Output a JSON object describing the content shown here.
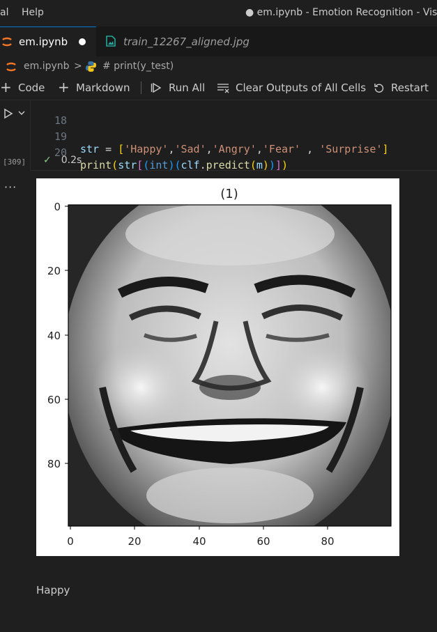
{
  "titlebar": {
    "menu": [
      "al",
      "Help"
    ],
    "title": "● em.ipynb - Emotion Recognition - Visua"
  },
  "tabs": [
    {
      "label": "em.ipynb",
      "modified": true
    },
    {
      "label": "train_12267_aligned.jpg"
    }
  ],
  "breadcrumb": {
    "file": "em.ipynb",
    "separator": ">",
    "cell": "# print(y_test)"
  },
  "toolbar": {
    "code_label": "Code",
    "markdown_label": "Markdown",
    "run_all_label": "Run All",
    "clear_label": "Clear Outputs of All Cells",
    "restart_label": "Restart"
  },
  "cell": {
    "line_numbers": [
      "18",
      "19",
      "20"
    ],
    "execution_count": "[309]",
    "duration": "0.2s"
  },
  "figure": {
    "image_title": "(1)",
    "y_ticks": [
      "0",
      "20",
      "40",
      "60",
      "80"
    ],
    "x_ticks": [
      "0",
      "20",
      "40",
      "60",
      "80"
    ],
    "image": "grayscale-face-icon"
  },
  "output": {
    "text": "Happy"
  },
  "colors": {
    "background": "#1f1f1f",
    "accent": "#0078d4",
    "jupyter_orange": "#f37626",
    "check_green": "#89d185"
  }
}
